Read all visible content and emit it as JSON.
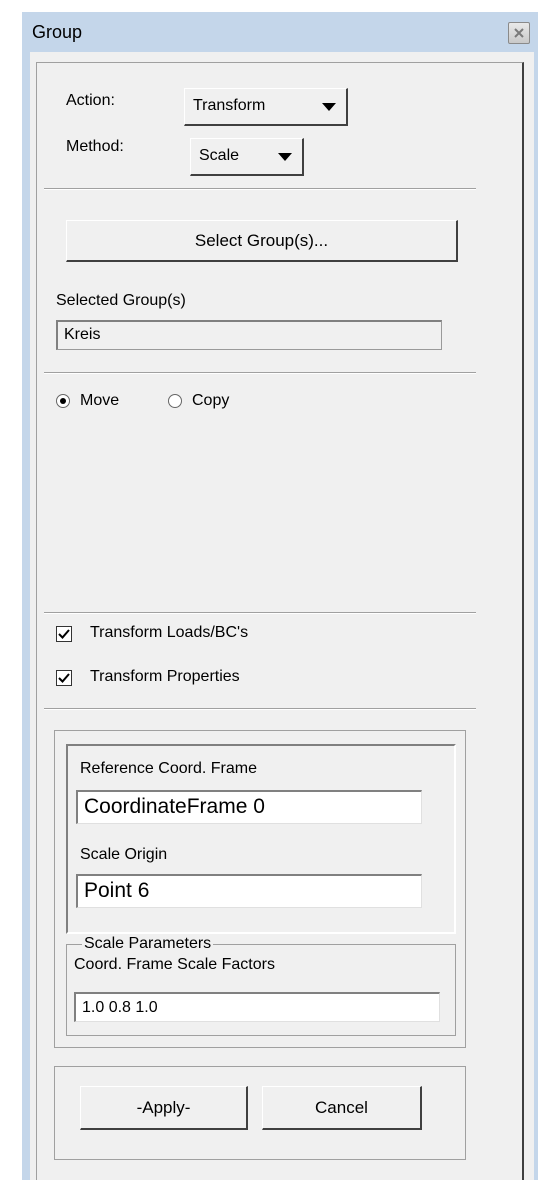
{
  "window": {
    "title": "Group"
  },
  "action": {
    "label": "Action:",
    "value": "Transform"
  },
  "method": {
    "label": "Method:",
    "value": "Scale"
  },
  "select_groups_button": "Select Group(s)...",
  "selected_groups": {
    "label": "Selected Group(s)",
    "value": "Kreis"
  },
  "mode": {
    "move_label": "Move",
    "copy_label": "Copy",
    "selected": "Move"
  },
  "options": {
    "transform_loads_label": "Transform Loads/BC's",
    "transform_loads_checked": true,
    "transform_properties_label": "Transform Properties",
    "transform_properties_checked": true
  },
  "reference_frame": {
    "label": "Reference Coord. Frame",
    "value": "CoordinateFrame 0"
  },
  "scale_origin": {
    "label": "Scale Origin",
    "value": "Point 6"
  },
  "scale_parameters": {
    "group_label": "Scale Parameters",
    "factors_label": "Coord. Frame Scale Factors",
    "factors_value": "1.0 0.8 1.0"
  },
  "buttons": {
    "apply": "-Apply-",
    "cancel": "Cancel"
  }
}
